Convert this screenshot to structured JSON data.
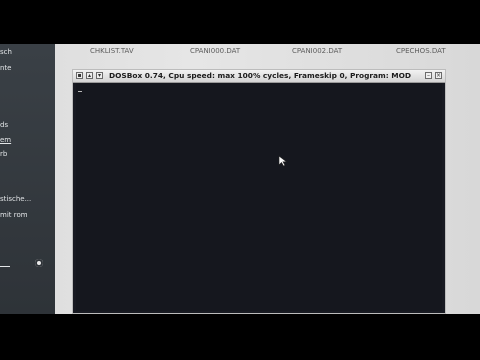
{
  "side_panel": {
    "items": [
      {
        "label": "sch",
        "style": "normal"
      },
      {
        "label": "nte",
        "style": "normal"
      },
      {
        "label": "ds",
        "style": "normal"
      },
      {
        "label": "em",
        "style": "underlined"
      },
      {
        "label": "rb",
        "style": "normal"
      },
      {
        "label": "stische...",
        "style": "normal"
      },
      {
        "label": "mit rom",
        "style": "normal"
      }
    ]
  },
  "desktop": {
    "files": [
      "CHKLIST.TAV",
      "CPANI000.DAT",
      "CPANI002.DAT",
      "CPECHOS.DAT"
    ]
  },
  "dosbox": {
    "title": "DOSBox 0.74, Cpu speed: max 100% cycles, Frameskip 0, Program:   MOD"
  },
  "colors": {
    "dos_background": "#15171e",
    "side_panel": "#2e3338",
    "desktop": "#e0e0e0"
  }
}
